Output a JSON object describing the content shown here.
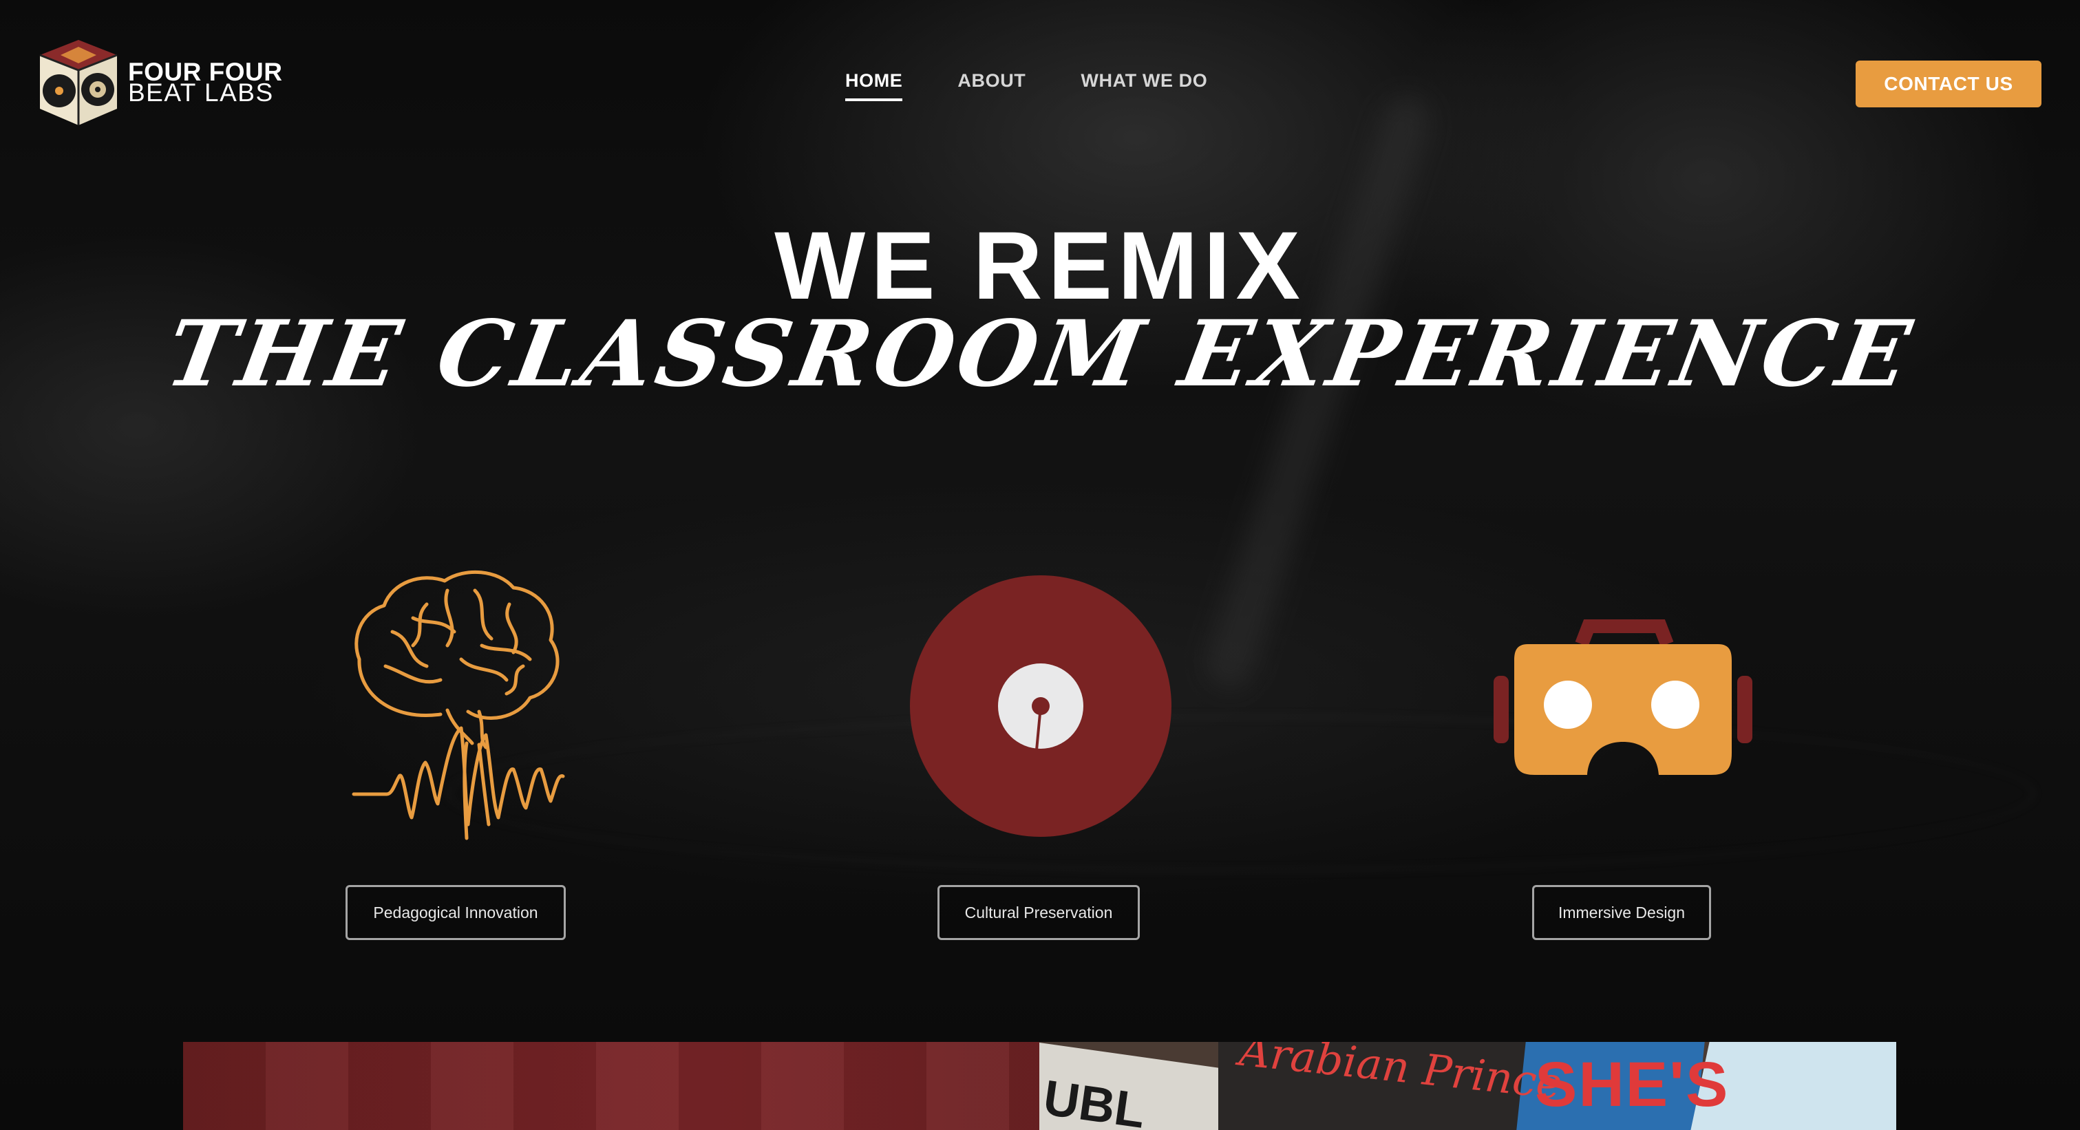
{
  "brand": {
    "line1": "FOUR FOUR",
    "line2": "BEAT LABS"
  },
  "nav": {
    "items": [
      {
        "label": "HOME",
        "active": true
      },
      {
        "label": "ABOUT",
        "active": false
      },
      {
        "label": "WHAT WE DO",
        "active": false
      }
    ]
  },
  "contact_label": "CONTACT US",
  "hero": {
    "headline": "WE REMIX",
    "subheadline": "THE CLASSROOM EXPERIENCE"
  },
  "features": [
    {
      "label": "Pedagogical Innovation",
      "icon": "brain-waveform-icon"
    },
    {
      "label": "Cultural Preservation",
      "icon": "vinyl-record-icon"
    },
    {
      "label": "Immersive Design",
      "icon": "vr-headset-icon"
    }
  ],
  "preview": {
    "record_title": "Arabian Prince",
    "record_text_2": "SHE'S",
    "record_text_3": "UBL"
  },
  "colors": {
    "accent": "#e89c40",
    "record": "#7a2323",
    "background": "#000000"
  }
}
